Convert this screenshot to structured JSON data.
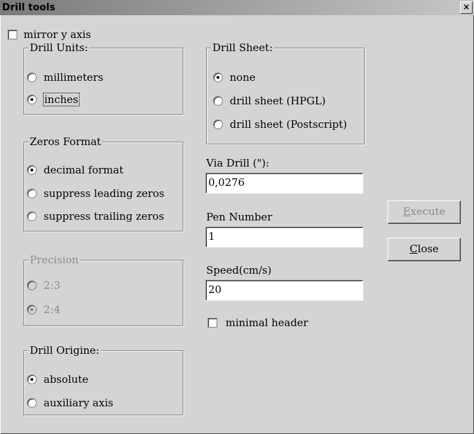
{
  "window": {
    "title": "Drill tools",
    "close_glyph": "×"
  },
  "mirror_y_axis": {
    "label": "mirror y axis",
    "checked": false
  },
  "drill_units": {
    "legend": "Drill Units:",
    "options": [
      {
        "label": "millimeters",
        "checked": false
      },
      {
        "label": "inches",
        "checked": true
      }
    ]
  },
  "zeros_format": {
    "legend": "Zeros Format",
    "options": [
      {
        "label": "decimal format",
        "checked": true
      },
      {
        "label": "suppress leading zeros",
        "checked": false
      },
      {
        "label": "suppress trailing zeros",
        "checked": false
      }
    ]
  },
  "precision": {
    "legend": "Precision",
    "enabled": false,
    "options": [
      {
        "label": "2:3",
        "checked": false
      },
      {
        "label": "2:4",
        "checked": true
      }
    ]
  },
  "drill_origine": {
    "legend": "Drill Origine:",
    "options": [
      {
        "label": "absolute",
        "checked": true
      },
      {
        "label": "auxiliary axis",
        "checked": false
      }
    ]
  },
  "drill_sheet": {
    "legend": "Drill Sheet:",
    "options": [
      {
        "label": "none",
        "checked": true
      },
      {
        "label": "drill sheet (HPGL)",
        "checked": false
      },
      {
        "label": "drill sheet (Postscript)",
        "checked": false
      }
    ]
  },
  "via_drill": {
    "label": "Via Drill (\"):",
    "value": "0,0276"
  },
  "pen_number": {
    "label": "Pen Number",
    "value": "1"
  },
  "speed": {
    "label": "Speed(cm/s)",
    "value": "20"
  },
  "minimal_header": {
    "label": "minimal header",
    "checked": false
  },
  "buttons": {
    "execute": {
      "mnemonic": "E",
      "rest": "xecute",
      "enabled": false
    },
    "close": {
      "mnemonic": "C",
      "rest": "lose",
      "enabled": true
    }
  }
}
